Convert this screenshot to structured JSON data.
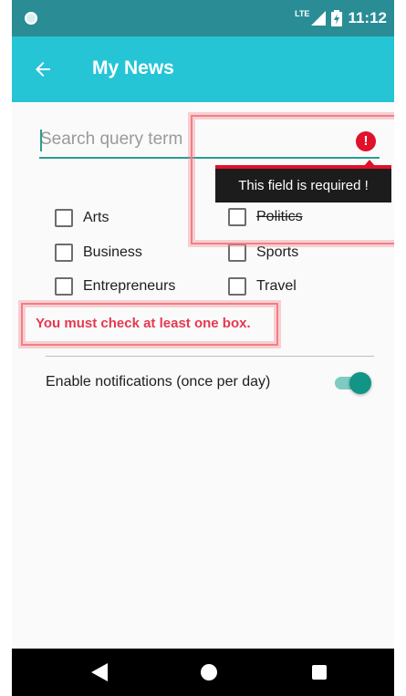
{
  "status_bar": {
    "network": "LTE",
    "time": "11:12"
  },
  "app_bar": {
    "title": "My News",
    "back_icon": "arrow-left-icon"
  },
  "search": {
    "placeholder": "Search query term",
    "value": "",
    "error_icon": "exclamation-circle-icon",
    "error_tooltip": "This field is required !"
  },
  "categories": {
    "left": [
      {
        "label": "Arts",
        "checked": false
      },
      {
        "label": "Business",
        "checked": false
      },
      {
        "label": "Entrepreneurs",
        "checked": false
      }
    ],
    "right": [
      {
        "label": "Politics",
        "checked": false
      },
      {
        "label": "Sports",
        "checked": false
      },
      {
        "label": "Travel",
        "checked": false
      }
    ],
    "error": "You must check at least one box."
  },
  "notifications": {
    "label": "Enable notifications (once per day)",
    "enabled": true
  },
  "colors": {
    "status_bar": "#2a8d96",
    "app_bar": "#25c5d6",
    "accent": "#129486",
    "error": "#e0112b",
    "highlight": "#f27e86"
  },
  "nav_bar": {
    "icons": [
      "back-triangle-icon",
      "home-circle-icon",
      "recents-square-icon"
    ]
  }
}
